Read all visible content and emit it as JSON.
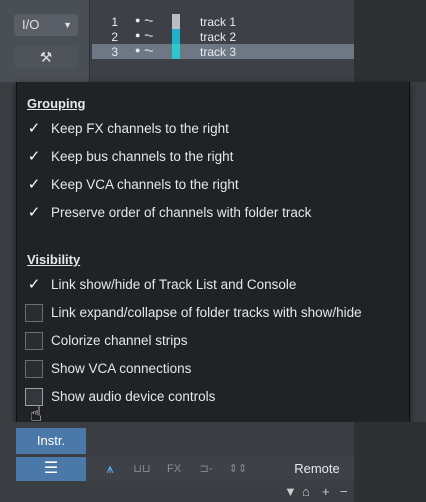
{
  "io": {
    "label": "I/O",
    "dropdown_arrow": "▼",
    "wrench_icon": "⚒"
  },
  "tracks": [
    {
      "num": "1",
      "name": "track 1",
      "color": "#b9bec4",
      "selected": false
    },
    {
      "num": "2",
      "name": "track 2",
      "color": "#23b1c9",
      "selected": false
    },
    {
      "num": "3",
      "name": "track 3",
      "color": "#2bc7cf",
      "selected": true
    }
  ],
  "track_glyphs": {
    "dot": "●",
    "wave": "⏦"
  },
  "grouping": {
    "title": "Grouping",
    "options": [
      {
        "label": "Keep FX channels to the right",
        "checked": true
      },
      {
        "label": "Keep bus channels to the right",
        "checked": true
      },
      {
        "label": "Keep VCA channels to the right",
        "checked": true
      },
      {
        "label": "Preserve order of channels with folder track",
        "checked": true
      }
    ]
  },
  "visibility": {
    "title": "Visibility",
    "options": [
      {
        "label": "Link show/hide of Track List and Console",
        "checked": true
      },
      {
        "label": "Link expand/collapse of folder tracks with show/hide",
        "checked": false
      },
      {
        "label": "Colorize channel strips",
        "checked": false
      },
      {
        "label": "Show VCA connections",
        "checked": false
      },
      {
        "label": "Show audio device controls",
        "checked": false
      }
    ]
  },
  "check_glyph": "✓",
  "bottom": {
    "instr_label": "Instr.",
    "list_icon": "☰",
    "tools": [
      {
        "icon": "waveform-icon",
        "glyph": "⩚",
        "active": true
      },
      {
        "icon": "keyboard-icon",
        "glyph": "⊔⊔",
        "active": false
      },
      {
        "icon": "fx-icon",
        "glyph": "FX",
        "active": false
      },
      {
        "icon": "routing-icon",
        "glyph": "⊐-",
        "active": false
      },
      {
        "icon": "updown-icon",
        "glyph": "⇕⇕",
        "active": false
      }
    ],
    "remote_label": "Remote",
    "mini": [
      "▼",
      "⌂",
      "+",
      "−"
    ]
  },
  "colors": {
    "accent": "#4a78a8",
    "active_tool": "#5fb6ff"
  }
}
